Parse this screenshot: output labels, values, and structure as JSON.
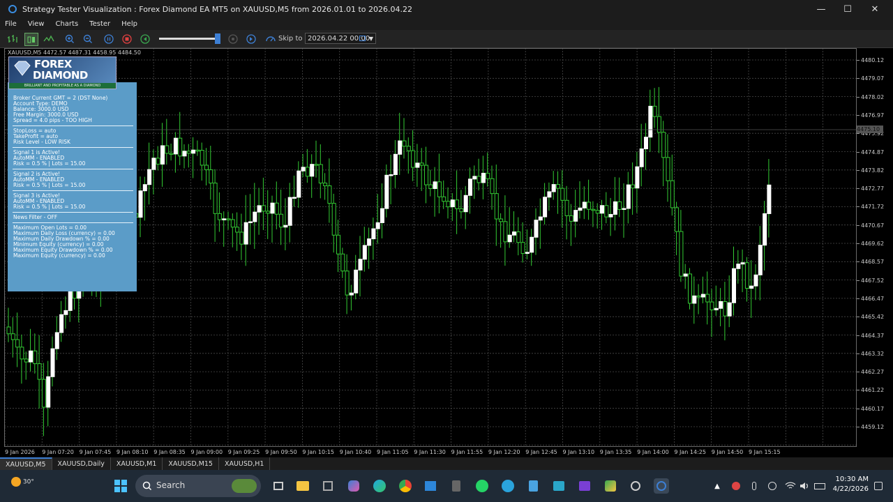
{
  "window": {
    "title": "Strategy Tester Visualization : Forex Diamond EA MT5 on XAUUSD,M5 from 2026.01.01 to 2026.04.22",
    "minimize": "—",
    "maximize": "☐",
    "close": "✕"
  },
  "menu": [
    "File",
    "View",
    "Charts",
    "Tester",
    "Help"
  ],
  "toolbar": {
    "skip_label": "Skip to",
    "skip_date": "2026.04.22 00:00"
  },
  "chart": {
    "ohlc_header": "XAUUSD,M5  4472.57 4487.31 4458.95 4484.50",
    "current_price": "4475.10",
    "price_labels": [
      "4480.12",
      "4479.07",
      "4478.02",
      "4476.97",
      "4475.92",
      "4474.87",
      "4473.82",
      "4472.77",
      "4471.72",
      "4470.67",
      "4469.62",
      "4468.57",
      "4467.52",
      "4466.47",
      "4465.42",
      "4464.37",
      "4463.32",
      "4462.27",
      "4461.22",
      "4460.17",
      "4459.12"
    ],
    "time_labels": [
      "9 Jan 2026",
      "9 Jan 07:20",
      "9 Jan 07:45",
      "9 Jan 08:10",
      "9 Jan 08:35",
      "9 Jan 09:00",
      "9 Jan 09:25",
      "9 Jan 09:50",
      "9 Jan 10:15",
      "9 Jan 10:40",
      "9 Jan 11:05",
      "9 Jan 11:30",
      "9 Jan 11:55",
      "9 Jan 12:20",
      "9 Jan 12:45",
      "9 Jan 13:10",
      "9 Jan 13:35",
      "9 Jan 14:00",
      "9 Jan 14:25",
      "9 Jan 14:50",
      "9 Jan 15:15"
    ],
    "colors": {
      "bull": "#ffffff",
      "bear": "#33cc33",
      "wick": "#33cc33",
      "grid": "#4a4a4a",
      "background": "#000000"
    }
  },
  "ea_panel": {
    "logo_line1": "FOREX",
    "logo_line2": "DIAMOND",
    "logo_tagline": "BRILLIANT AND PROFITABLE AS A DIAMOND",
    "groups": [
      [
        "Broker Current GMT = 2  (DST None)",
        "Account Type:  DEMO",
        "Balance: 3000.0 USD",
        "Free Margin: 3000.0 USD",
        "Spread = 4.0 pips - TOO HIGH"
      ],
      [
        "StopLoss = auto",
        "TakeProfit = auto",
        "Risk Level - LOW RISK"
      ],
      [
        "Signal 1 is Active!",
        "AutoMM - ENABLED",
        "Risk = 0.5 % | Lots = 15.00"
      ],
      [
        "Signal 2 is Active!",
        "AutoMM - ENABLED",
        "Risk = 0.5 % | Lots = 15.00"
      ],
      [
        "Signal 3 is Active!",
        "AutoMM - ENABLED",
        "Risk = 0.5 % | Lots = 15.00"
      ],
      [
        "News Filter - OFF"
      ],
      [
        "Maximum Open Lots = 0.00",
        "Maximum Daily Loss (currency) = 0.00",
        "Maximum Daily Drawdown % = 0.00",
        "Minimum Equity (currency) = 0.00",
        "Maximum Equity Drawdown % = 0.00",
        "Maximum Equity (currency) = 0.00"
      ]
    ],
    "background": "#5b9cc8"
  },
  "tabs": [
    "XAUUSD,M5",
    "XAUUSD,Daily",
    "XAUUSD,M1",
    "XAUUSD,M15",
    "XAUUSD,H1"
  ],
  "taskbar": {
    "weather": "30°",
    "search_placeholder": "Search",
    "time": "10:30 AM",
    "date": "4/22/2026"
  }
}
